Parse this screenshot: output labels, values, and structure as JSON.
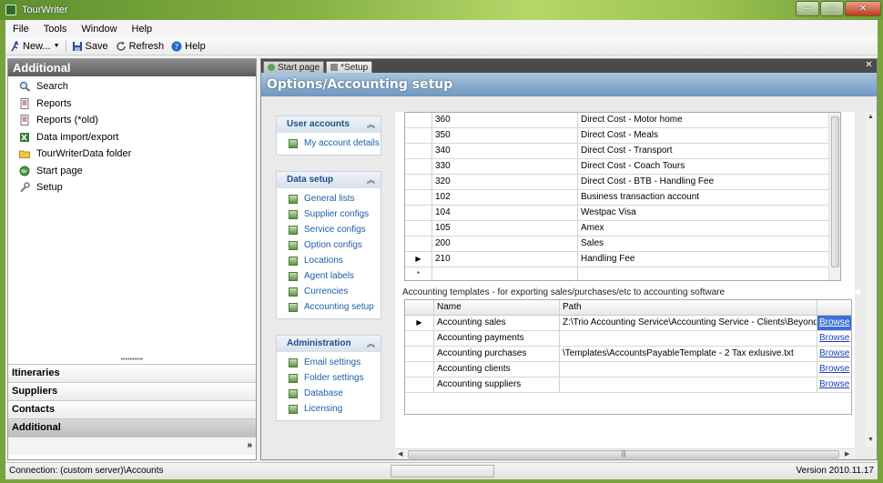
{
  "window": {
    "title": "TourWriter",
    "controls": [
      "–",
      "□",
      "✕"
    ]
  },
  "menu": [
    "File",
    "Tools",
    "Window",
    "Help"
  ],
  "toolbar": {
    "new": "New...",
    "save": "Save",
    "refresh": "Refresh",
    "help": "Help"
  },
  "left": {
    "title": "Additional",
    "items": [
      "Search",
      "Reports",
      "Reports (*old)",
      "Data import/export",
      "TourWriterData folder",
      "Start page",
      "Setup"
    ],
    "sections": [
      "Itineraries",
      "Suppliers",
      "Contacts",
      "Additional"
    ],
    "footer_glyph": "»"
  },
  "tabs": [
    "Start page",
    "*Setup"
  ],
  "page_title": "Options/Accounting setup",
  "sidebar": {
    "user_accounts": {
      "title": "User accounts",
      "items": [
        "My account details"
      ]
    },
    "data_setup": {
      "title": "Data setup",
      "items": [
        "General lists",
        "Supplier configs",
        "Service configs",
        "Option configs",
        "Locations",
        "Agent labels",
        "Currencies",
        "Accounting setup"
      ]
    },
    "administration": {
      "title": "Administration",
      "items": [
        "Email settings",
        "Folder settings",
        "Database",
        "Licensing"
      ]
    }
  },
  "codes_grid": {
    "rows": [
      {
        "code": "360",
        "name": "Direct Cost - Motor home"
      },
      {
        "code": "350",
        "name": "Direct Cost - Meals"
      },
      {
        "code": "340",
        "name": "Direct Cost - Transport"
      },
      {
        "code": "330",
        "name": "Direct Cost - Coach Tours"
      },
      {
        "code": "320",
        "name": "Direct Cost - BTB - Handling Fee"
      },
      {
        "code": "102",
        "name": "Business transaction account"
      },
      {
        "code": "104",
        "name": "Westpac Visa"
      },
      {
        "code": "105",
        "name": "Amex"
      },
      {
        "code": "200",
        "name": "Sales"
      },
      {
        "code": "210",
        "name": "Handling Fee"
      }
    ],
    "new_row_marker": "*"
  },
  "templates": {
    "label": "Accounting templates - for exporting sales/purchases/etc to accounting software",
    "headers": {
      "name": "Name",
      "path": "Path"
    },
    "browse_label": "Browse",
    "rows": [
      {
        "name": "Accounting sales",
        "path": "Z:\\Trio Accounting Service\\Accounting Service - Clients\\Beyond the blue..."
      },
      {
        "name": "Accounting payments",
        "path": ""
      },
      {
        "name": "Accounting purchases",
        "path": "\\Templates\\AccountsPayableTemplate - 2 Tax exlusive.txt"
      },
      {
        "name": "Accounting clients",
        "path": ""
      },
      {
        "name": "Accounting suppliers",
        "path": ""
      }
    ]
  },
  "status": {
    "connection": "Connection: (custom server)\\Accounts",
    "version": "Version 2010.11.17"
  }
}
